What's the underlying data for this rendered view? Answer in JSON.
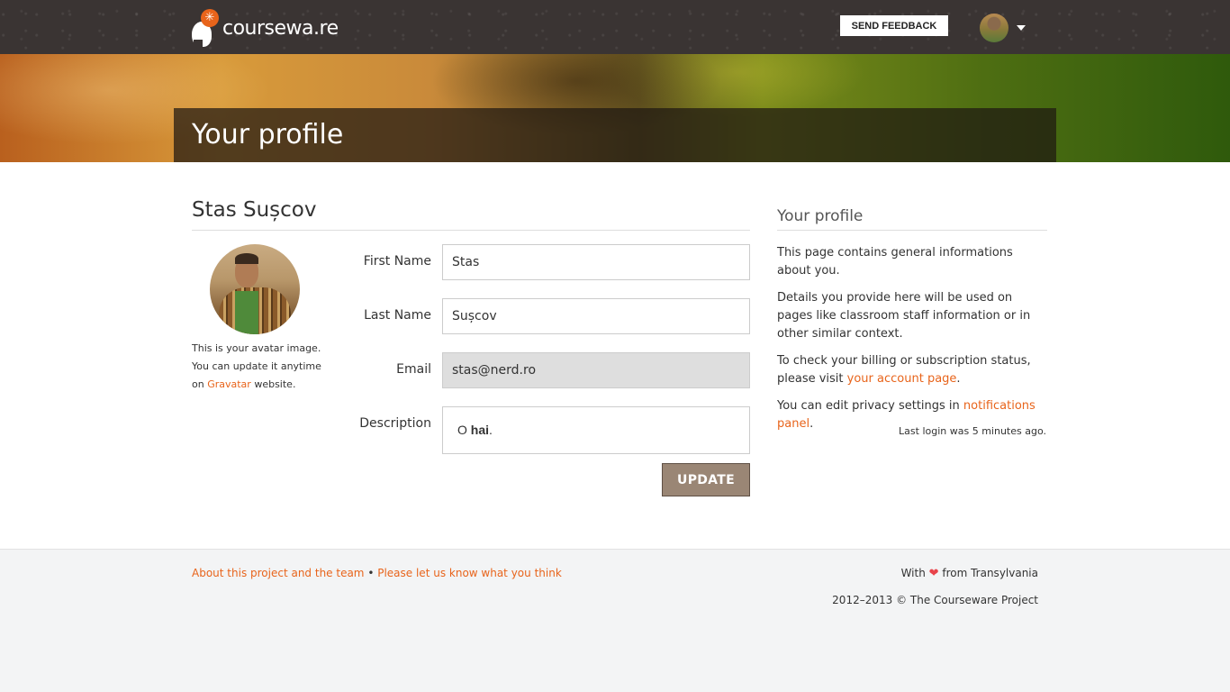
{
  "header": {
    "logo_text": "coursewa.re",
    "feedback_label": "SEND FEEDBACK",
    "logo_sun_glyph": "✳"
  },
  "hero": {
    "title": "Your profile"
  },
  "profile": {
    "name": "Stas Sușcov",
    "avatar_note_1": "This is your avatar image. You can update it anytime on ",
    "avatar_note_link": "Gravatar",
    "avatar_note_2": " website."
  },
  "form": {
    "first_name_label": "First Name",
    "first_name_value": "Stas",
    "last_name_label": "Last Name",
    "last_name_value": "Sușcov",
    "email_label": "Email",
    "email_value": "stas@nerd.ro",
    "description_label": "Description",
    "description_prefix": "O ",
    "description_bold": "hai",
    "description_suffix": ".",
    "update_label": "UPDATE"
  },
  "sidebar": {
    "title": "Your profile",
    "p1": "This page contains general informations about you.",
    "p2": "Details you provide here will be used on pages like classroom staff information or in other similar context.",
    "p3_before": "To check your billing or subscription status, please visit ",
    "p3_link": "your account page",
    "p3_after": ".",
    "p4_before": "You can edit privacy settings in ",
    "p4_link": "notifications panel",
    "p4_after": ".",
    "last_login": "Last login was 5 minutes ago."
  },
  "footer": {
    "link_about": "About this project and the team",
    "separator": " • ",
    "link_feedback": "Please let us know what you think",
    "with": "With ",
    "heart": "❤",
    "from": " from Transylvania",
    "copyright": "2012–2013 © The Courseware Project"
  },
  "colors": {
    "accent": "#e8641b",
    "topbar": "#3a3433",
    "button": "#9a8675"
  }
}
